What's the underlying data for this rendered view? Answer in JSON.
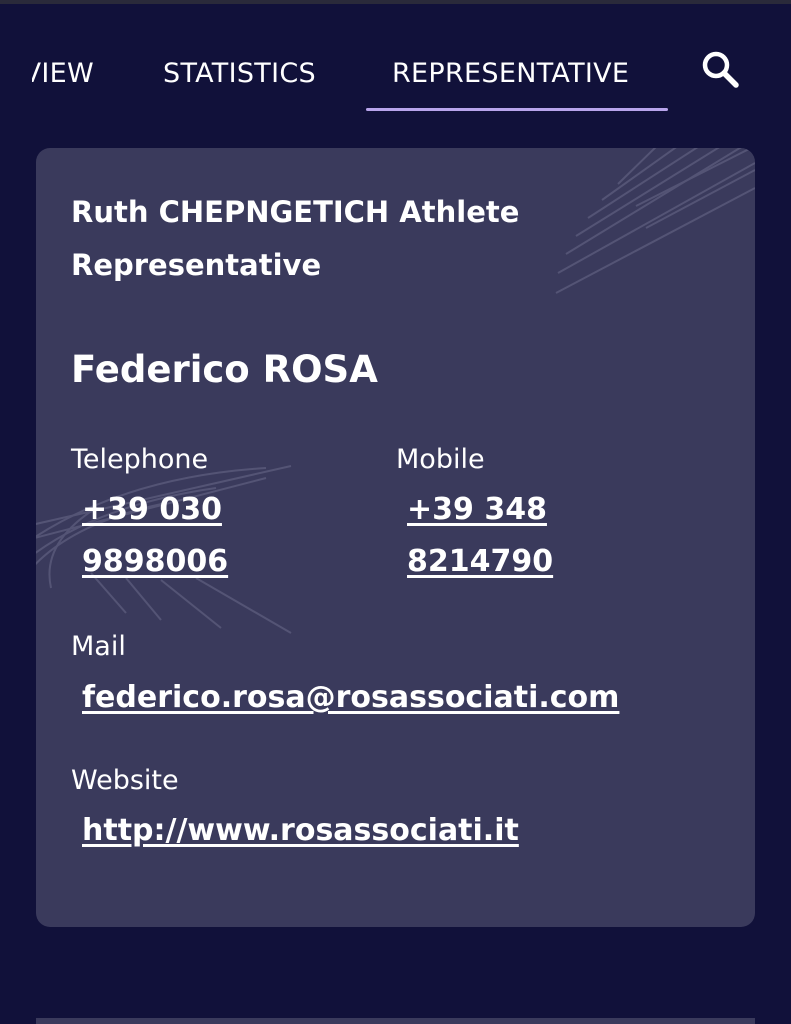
{
  "tabs": {
    "overview_label": "OVERVIEW",
    "statistics_label": "STATISTICS",
    "representative_label": "REPRESENTATIVE",
    "active": "REPRESENTATIVE",
    "accent_color": "#b9a5ec"
  },
  "search": {
    "icon": "search-icon"
  },
  "card": {
    "title": "Ruth CHEPNGETICH Athlete Representative",
    "name": "Federico ROSA",
    "telephone_label": "Telephone",
    "telephone_value": "+39 030 9898006",
    "mobile_label": "Mobile",
    "mobile_value": "+39 348 8214790",
    "mail_label": "Mail",
    "mail_value": "federico.rosa@rosassociati.com",
    "website_label": "Website",
    "website_value": "http://www.rosassociati.it"
  },
  "colors": {
    "background": "#11113a",
    "card": "#3a3a5c",
    "text": "#ffffff"
  }
}
